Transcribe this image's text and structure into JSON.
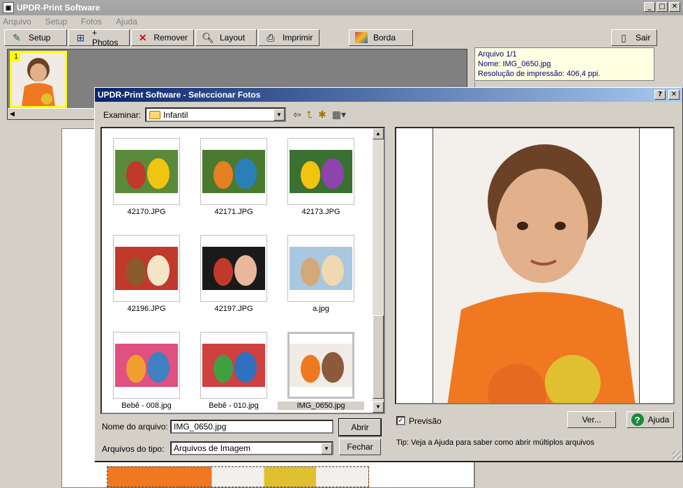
{
  "app": {
    "title": "UPDR-Print Software",
    "menu": [
      "Arquivo",
      "Setup",
      "Fotos",
      "Ajuda"
    ],
    "toolbar": {
      "setup": "Setup",
      "add_photos": "+ Photos",
      "remove": "Remover",
      "layout": "Layout",
      "print": "Imprimir",
      "border": "Borda",
      "exit": "Sair"
    },
    "strip_number": "1",
    "info": {
      "line1": "Arquivo 1/1",
      "line2": "Nome: IMG_0650.jpg",
      "line3": "Resolução de impressão: 406,4 ppi."
    }
  },
  "dialog": {
    "title": "UPDR-Print Software - Seleccionar Fotos",
    "help_btn": "?",
    "close_btn": "✕",
    "look_in_label": "Examinar:",
    "look_in_value": "Infantil",
    "files": [
      {
        "name": "42170.JPG",
        "colors": [
          "#5a8a3a",
          "#c0392b",
          "#f1c40f"
        ]
      },
      {
        "name": "42171.JPG",
        "colors": [
          "#4a7a30",
          "#e67e22",
          "#2980b9"
        ]
      },
      {
        "name": "42173.JPG",
        "colors": [
          "#3a7030",
          "#f1c40f",
          "#8e44ad"
        ]
      },
      {
        "name": "42196.JPG",
        "colors": [
          "#c0392b",
          "#8b5a2b",
          "#f5e6c8"
        ]
      },
      {
        "name": "42197.JPG",
        "colors": [
          "#1a1a1a",
          "#c0392b",
          "#e8b89a"
        ]
      },
      {
        "name": "a.jpg",
        "colors": [
          "#a8c8e0",
          "#d4a878",
          "#f0d8b0"
        ]
      },
      {
        "name": "Bebê - 008.jpg",
        "colors": [
          "#e05080",
          "#f0a030",
          "#4080c0"
        ]
      },
      {
        "name": "Bebê - 010.jpg",
        "colors": [
          "#d04040",
          "#40a040",
          "#3070c0"
        ]
      },
      {
        "name": "IMG_0650.jpg",
        "colors": [
          "#f0ebe5",
          "#f07820",
          "#8b5a3a"
        ]
      }
    ],
    "filename_label": "Nome do arquivo:",
    "filename_value": "IMG_0650.jpg",
    "filetype_label": "Arquivos do tipo:",
    "filetype_value": "Arquivos de Imagem",
    "open_btn": "Abrir",
    "cancel_btn": "Fechar",
    "preview_label": "Previsão",
    "view_btn": "Ver...",
    "help_btn_label": "Ajuda",
    "tip": "Tip: Veja a Ajuda para saber como abrir múltiplos arquivos"
  }
}
